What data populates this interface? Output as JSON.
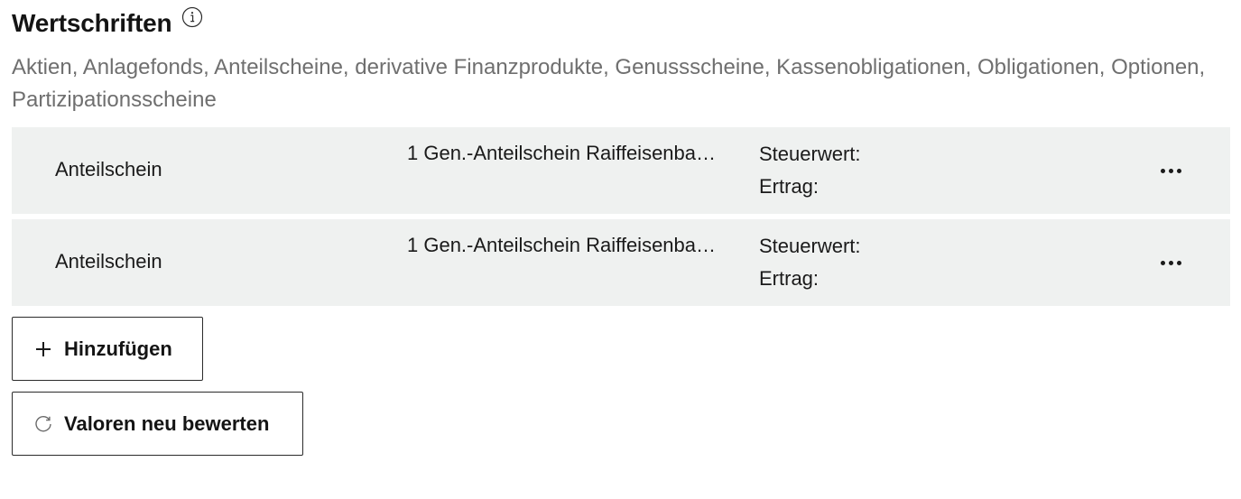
{
  "section": {
    "title": "Wertschriften",
    "info_icon": "info-icon",
    "subtitle": "Aktien, Anlagefonds, Anteilscheine, derivative Finanzprodukte, Genussscheine, Kassenobligationen, Obligationen, Optionen, Partizipationsscheine"
  },
  "rows": [
    {
      "type": "Anteilschein",
      "name": "1 Gen.-Anteilschein Raiffeisenba…",
      "tax_value_label": "Steuerwert:",
      "income_label": "Ertrag:",
      "more_icon": "more-horizontal-icon"
    },
    {
      "type": "Anteilschein",
      "name": "1 Gen.-Anteilschein Raiffeisenba…",
      "tax_value_label": "Steuerwert:",
      "income_label": "Ertrag:",
      "more_icon": "more-horizontal-icon"
    }
  ],
  "actions": {
    "add_label": "Hinzufügen",
    "add_icon": "plus-icon",
    "revalue_label": "Valoren neu bewerten",
    "revalue_icon": "refresh-icon"
  },
  "colors": {
    "row_background": "#eff1f0",
    "subtitle_text": "#6f6f6f",
    "primary_text": "#141414"
  }
}
